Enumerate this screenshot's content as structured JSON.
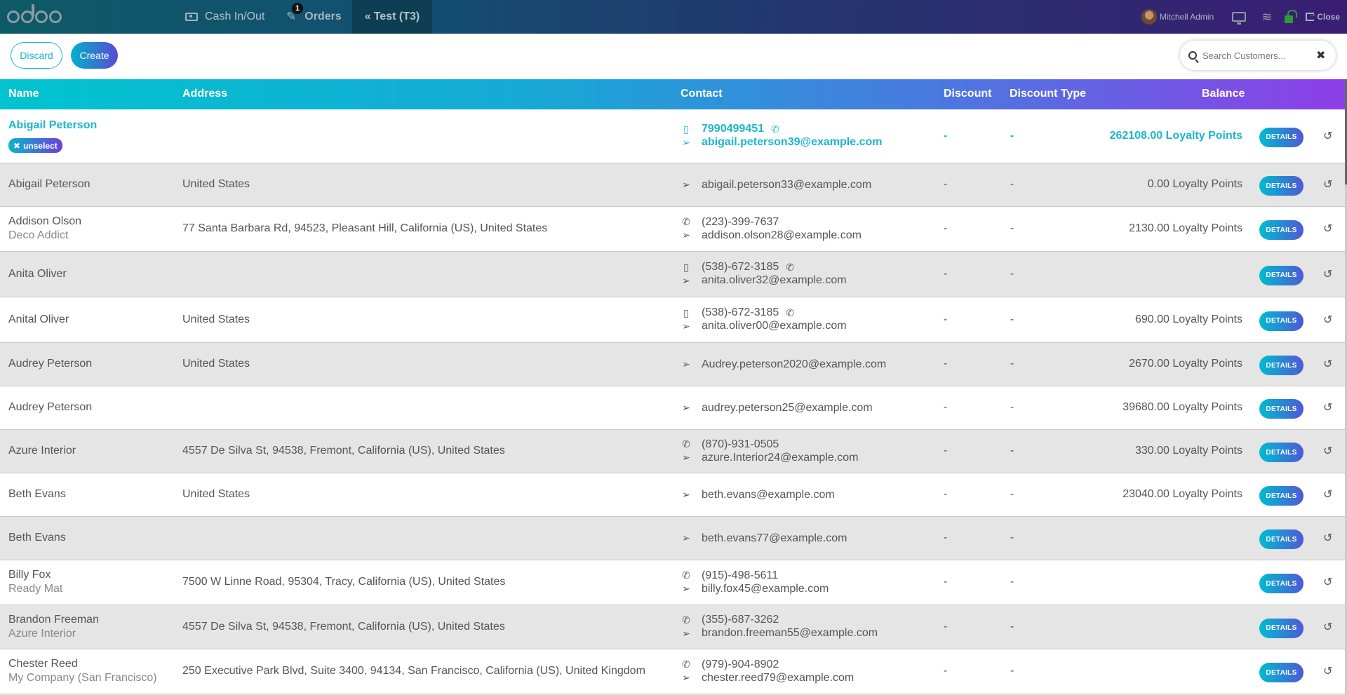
{
  "navbar": {
    "logo": "odoo",
    "cash_label": "Cash In/Out",
    "orders_label": "Orders",
    "orders_badge": "1",
    "tab_label": "Test (T3)",
    "user": "Mitchell Admin",
    "close_label": "Close"
  },
  "controls": {
    "discard_label": "Discard",
    "create_label": "Create",
    "search_placeholder": "Search Customers..."
  },
  "table": {
    "headers": {
      "name": "Name",
      "address": "Address",
      "contact": "Contact",
      "discount": "Discount",
      "discount_type": "Discount Type",
      "balance": "Balance"
    },
    "details_label": "DETAILS",
    "unselect_label": "unselect",
    "rows": [
      {
        "name": "Abigail Peterson",
        "company": "",
        "address": "",
        "phone": "7990499451",
        "phone_type": "mobile",
        "whatsapp": true,
        "email": "abigail.peterson39@example.com",
        "discount": "-",
        "discount_type": "-",
        "balance": "262108.00 Loyalty Points"
      },
      {
        "name": "Abigail Peterson",
        "company": "",
        "address": "United States",
        "phone": "",
        "phone_type": "",
        "whatsapp": false,
        "email": "abigail.peterson33@example.com",
        "discount": "-",
        "discount_type": "-",
        "balance": "0.00 Loyalty Points"
      },
      {
        "name": "Addison Olson",
        "company": "Deco Addict",
        "address": "77 Santa Barbara Rd, 94523, Pleasant Hill, California (US), United States",
        "phone": "(223)-399-7637",
        "phone_type": "phone",
        "whatsapp": false,
        "email": "addison.olson28@example.com",
        "discount": "-",
        "discount_type": "-",
        "balance": "2130.00 Loyalty Points"
      },
      {
        "name": "Anita Oliver",
        "company": "",
        "address": "",
        "phone": "(538)-672-3185",
        "phone_type": "mobile",
        "whatsapp": true,
        "email": "anita.oliver32@example.com",
        "discount": "-",
        "discount_type": "-",
        "balance": ""
      },
      {
        "name": "Anital Oliver",
        "company": "",
        "address": "United States",
        "phone": "(538)-672-3185",
        "phone_type": "mobile",
        "whatsapp": true,
        "email": "anita.oliver00@example.com",
        "discount": "-",
        "discount_type": "-",
        "balance": "690.00 Loyalty Points"
      },
      {
        "name": "Audrey Peterson",
        "company": "",
        "address": "United States",
        "phone": "",
        "phone_type": "",
        "whatsapp": false,
        "email": "Audrey.peterson2020@example.com",
        "discount": "-",
        "discount_type": "-",
        "balance": "2670.00 Loyalty Points"
      },
      {
        "name": "Audrey Peterson",
        "company": "",
        "address": "",
        "phone": "",
        "phone_type": "",
        "whatsapp": false,
        "email": "audrey.peterson25@example.com",
        "discount": "-",
        "discount_type": "-",
        "balance": "39680.00 Loyalty Points"
      },
      {
        "name": "Azure Interior",
        "company": "",
        "address": "4557 De Silva St, 94538, Fremont, California (US), United States",
        "phone": "(870)-931-0505",
        "phone_type": "phone",
        "whatsapp": false,
        "email": "azure.Interior24@example.com",
        "discount": "-",
        "discount_type": "-",
        "balance": "330.00 Loyalty Points"
      },
      {
        "name": "Beth Evans",
        "company": "",
        "address": "United States",
        "phone": "",
        "phone_type": "",
        "whatsapp": false,
        "email": "beth.evans@example.com",
        "discount": "-",
        "discount_type": "-",
        "balance": "23040.00 Loyalty Points"
      },
      {
        "name": "Beth Evans",
        "company": "",
        "address": "",
        "phone": "",
        "phone_type": "",
        "whatsapp": false,
        "email": "beth.evans77@example.com",
        "discount": "-",
        "discount_type": "-",
        "balance": ""
      },
      {
        "name": "Billy Fox",
        "company": "Ready Mat",
        "address": "7500 W Linne Road, 95304, Tracy, California (US), United States",
        "phone": "(915)-498-5611",
        "phone_type": "phone",
        "whatsapp": false,
        "email": "billy.fox45@example.com",
        "discount": "-",
        "discount_type": "-",
        "balance": ""
      },
      {
        "name": "Brandon Freeman",
        "company": "Azure Interior",
        "address": "4557 De Silva St, 94538, Fremont, California (US), United States",
        "phone": "(355)-687-3262",
        "phone_type": "phone",
        "whatsapp": false,
        "email": "brandon.freeman55@example.com",
        "discount": "-",
        "discount_type": "-",
        "balance": ""
      },
      {
        "name": "Chester Reed",
        "company": "My Company (San Francisco)",
        "address": "250 Executive Park Blvd, Suite 3400, 94134, San Francisco, California (US), United Kingdom",
        "phone": "(979)-904-8902",
        "phone_type": "phone",
        "whatsapp": false,
        "email": "chester.reed79@example.com",
        "discount": "-",
        "discount_type": "-",
        "balance": ""
      }
    ]
  }
}
